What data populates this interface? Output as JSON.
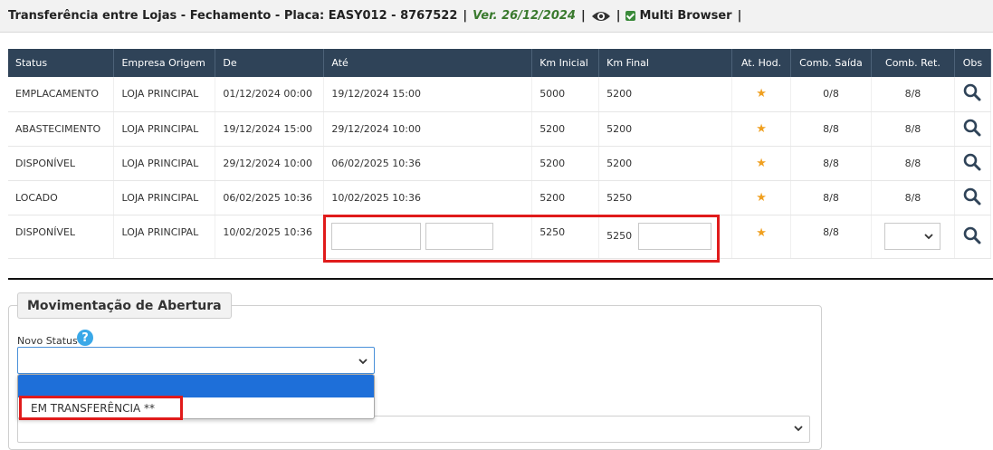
{
  "header": {
    "title": "Transferência entre Lojas - Fechamento - Placa: EASY012 - 8767522",
    "version": "Ver. 26/12/2024",
    "sep": "|",
    "multi_browser": "Multi Browser"
  },
  "table": {
    "columns": [
      "Status",
      "Empresa Origem",
      "De",
      "Até",
      "Km Inicial",
      "Km Final",
      "At. Hod.",
      "Comb. Saída",
      "Comb. Ret.",
      "Obs"
    ],
    "rows": [
      {
        "status": "EMPLACAMENTO",
        "origem": "LOJA PRINCIPAL",
        "de": "01/12/2024 00:00",
        "ate": "19/12/2024 15:00",
        "km_ini": "5000",
        "km_fim": "5200",
        "saida": "0/8",
        "ret": "8/8"
      },
      {
        "status": "ABASTECIMENTO",
        "origem": "LOJA PRINCIPAL",
        "de": "19/12/2024 15:00",
        "ate": "29/12/2024 10:00",
        "km_ini": "5200",
        "km_fim": "5200",
        "saida": "8/8",
        "ret": "8/8"
      },
      {
        "status": "DISPONÍVEL",
        "origem": "LOJA PRINCIPAL",
        "de": "29/12/2024 10:00",
        "ate": "06/02/2025 10:36",
        "km_ini": "5200",
        "km_fim": "5200",
        "saida": "8/8",
        "ret": "8/8"
      },
      {
        "status": "LOCADO",
        "origem": "LOJA PRINCIPAL",
        "de": "06/02/2025 10:36",
        "ate": "10/02/2025 10:36",
        "km_ini": "5200",
        "km_fim": "5250",
        "saida": "8/8",
        "ret": "8/8"
      },
      {
        "status": "DISPONÍVEL",
        "origem": "LOJA PRINCIPAL",
        "de": "10/02/2025 10:36",
        "ate": "",
        "km_ini": "5250",
        "km_fim": "5250",
        "saida": "8/8",
        "ret": ""
      }
    ],
    "star": "★"
  },
  "form": {
    "legend": "Movimentação de Abertura",
    "novo_status_label": "Novo Status*",
    "help": "?",
    "options": [
      "",
      "EM TRANSFERÊNCIA **"
    ]
  },
  "colors": {
    "header_bg": "#2f4358",
    "highlight": "#e01b1b",
    "selected_option": "#1e6fd9"
  }
}
